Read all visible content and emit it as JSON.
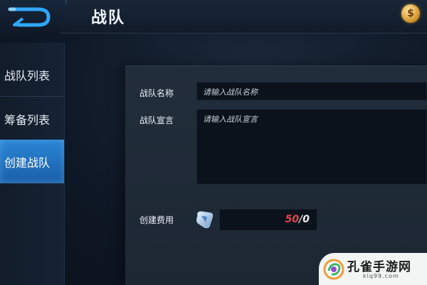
{
  "header": {
    "title": "战队",
    "back_icon": "back-arrow-icon",
    "currency_icon": "gold-coin-icon"
  },
  "sidebar": {
    "items": [
      {
        "label": "战队列表",
        "active": false
      },
      {
        "label": "筹备列表",
        "active": false
      },
      {
        "label": "创建战队",
        "active": true
      }
    ]
  },
  "form": {
    "name_label": "战队名称",
    "name_placeholder": "请输入战队名称",
    "manifesto_label": "战队宣言",
    "manifesto_placeholder": "请输入战队宣言",
    "cost_label": "创建费用",
    "cost_icon": "diamond-coupon-icon",
    "cost_current": "50",
    "cost_separator": "/",
    "cost_total": "0"
  },
  "watermark": {
    "text": "孔雀手游网",
    "sub": "klq99.com"
  },
  "colors": {
    "accent": "#2a86d6",
    "cost_current": "#e3474f"
  }
}
